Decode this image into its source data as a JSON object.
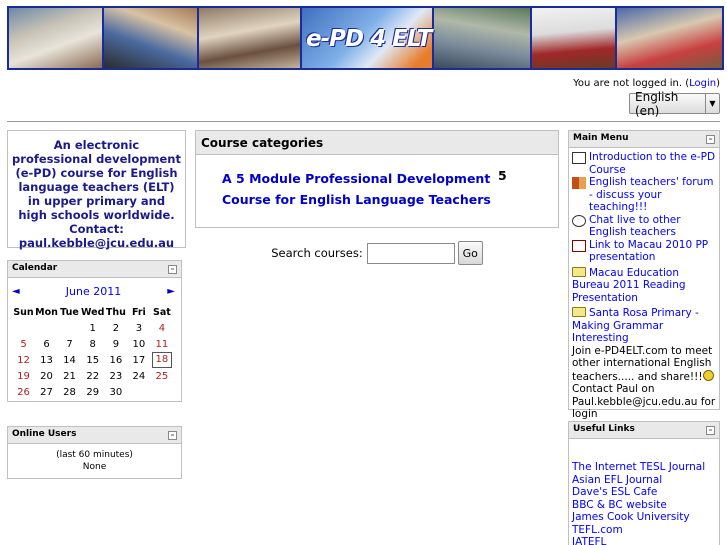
{
  "banner": {
    "logo_text": "e-PD 4 ELT"
  },
  "header": {
    "login_prefix": "You are not logged in. (",
    "login_link": "Login",
    "login_suffix": ")",
    "language_value": "English (en)"
  },
  "intro_block": {
    "text": "An electronic professional development (e-PD) course for English language teachers (ELT) in upper primary and high schools worldwide. Contact: paul.kebble@jcu.edu.au"
  },
  "calendar": {
    "title": "Calendar",
    "prev": "◄",
    "next": "►",
    "month": "June 2011",
    "days": [
      "Sun",
      "Mon",
      "Tue",
      "Wed",
      "Thu",
      "Fri",
      "Sat"
    ],
    "weeks": [
      [
        "",
        "",
        "",
        "1",
        "2",
        "3",
        "4"
      ],
      [
        "5",
        "6",
        "7",
        "8",
        "9",
        "10",
        "11"
      ],
      [
        "12",
        "13",
        "14",
        "15",
        "16",
        "17",
        "18"
      ],
      [
        "19",
        "20",
        "21",
        "22",
        "23",
        "24",
        "25"
      ],
      [
        "26",
        "27",
        "28",
        "29",
        "30",
        "",
        ""
      ]
    ],
    "today": "18"
  },
  "online_users": {
    "title": "Online Users",
    "period": "(last 60 minutes)",
    "users": "None"
  },
  "categories": {
    "title": "Course categories",
    "items": [
      {
        "name": "A 5 Module Professional Development Course for English Language Teachers",
        "count": "5"
      }
    ]
  },
  "search": {
    "label": "Search courses:",
    "value": "",
    "button": "Go"
  },
  "main_menu": {
    "title": "Main Menu",
    "items": [
      {
        "icon": "document-icon",
        "label": "Introduction to the e-PD Course"
      },
      {
        "icon": "forum-icon",
        "label": "English teachers' forum - discuss your teaching!!!"
      },
      {
        "icon": "chat-icon",
        "label": "Chat live to other English teachers"
      },
      {
        "icon": "presentation-icon",
        "label": "Link to Macau 2010 PP presentation"
      },
      {
        "icon": "folder-icon",
        "label": "Macau Education Bureau 2011 Reading Presentation"
      },
      {
        "icon": "folder-icon",
        "label": "Santa Rosa Primary - Making Grammar Interesting"
      }
    ],
    "note1": "Join e-PD4ELT.com to meet other international English teachers..... and share!!!",
    "note2": "Contact Paul on Paul.kebble@jcu.edu.au for login"
  },
  "useful_links": {
    "title": "Useful Links",
    "items": [
      "The Internet TESL Journal",
      "Asian EFL Journal",
      "Dave's ESL Cafe",
      "BBC & BC website",
      "James Cook University",
      "TEFL.com",
      "IATEFL"
    ]
  },
  "colors": {
    "link": "#0000ff",
    "intro_text": "#1a1a8c",
    "banner_border": "#1a2b9a",
    "weekend": "#b02020"
  }
}
